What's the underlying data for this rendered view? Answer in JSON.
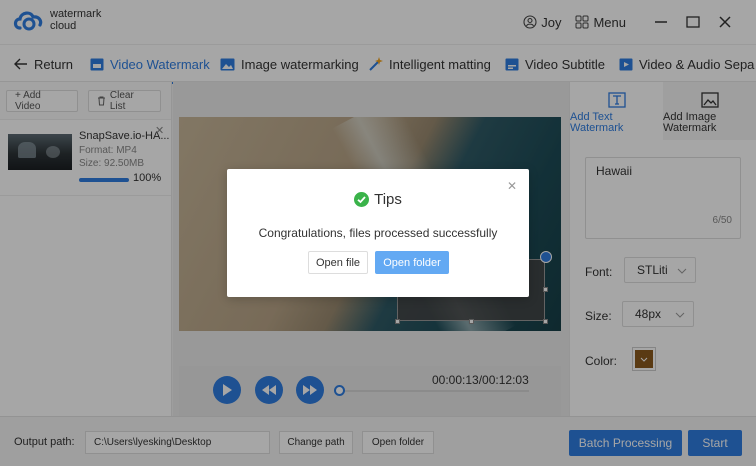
{
  "app": {
    "brand_line1": "watermark",
    "brand_line2": "cloud",
    "user_name": "Joy",
    "menu_label": "Menu"
  },
  "tabs": [
    {
      "label": "Return"
    },
    {
      "label": "Video Watermark",
      "active": true
    },
    {
      "label": "Image watermarking"
    },
    {
      "label": "Intelligent matting"
    },
    {
      "label": "Video Subtitle"
    },
    {
      "label": "Video & Audio Sepa"
    }
  ],
  "left_panel": {
    "add_video": "+ Add Video",
    "clear_list": "Clear List",
    "file": {
      "name": "SnapSave.io-HA...",
      "format": "Format:  MP4",
      "size": "Size:  92.50MB",
      "progress_text": "100%",
      "progress_fraction": 1.0
    }
  },
  "player": {
    "time": "00:00:13/00:12:03",
    "seek_fraction": 0.0
  },
  "right_panel": {
    "tab_text": "Add Text\nWatermark",
    "tab_image": "Add Image\nWatermark",
    "text_value": "Hawaii",
    "counter": "6/50",
    "font_label": "Font:",
    "font_value": "STLiti",
    "size_label": "Size:",
    "size_value": "48px",
    "color_label": "Color:",
    "color_value": "#8b5a1e"
  },
  "bottom": {
    "output_label": "Output path:",
    "output_path": "C:\\Users\\lyesking\\Desktop",
    "change_path": "Change path",
    "open_folder": "Open folder",
    "batch": "Batch Processing",
    "start": "Start"
  },
  "dialog": {
    "title": "Tips",
    "message": "Congratulations, files processed successfully",
    "open_file": "Open file",
    "open_folder": "Open folder"
  },
  "colors": {
    "accent": "#2f7de1",
    "success": "#3ab34a"
  }
}
